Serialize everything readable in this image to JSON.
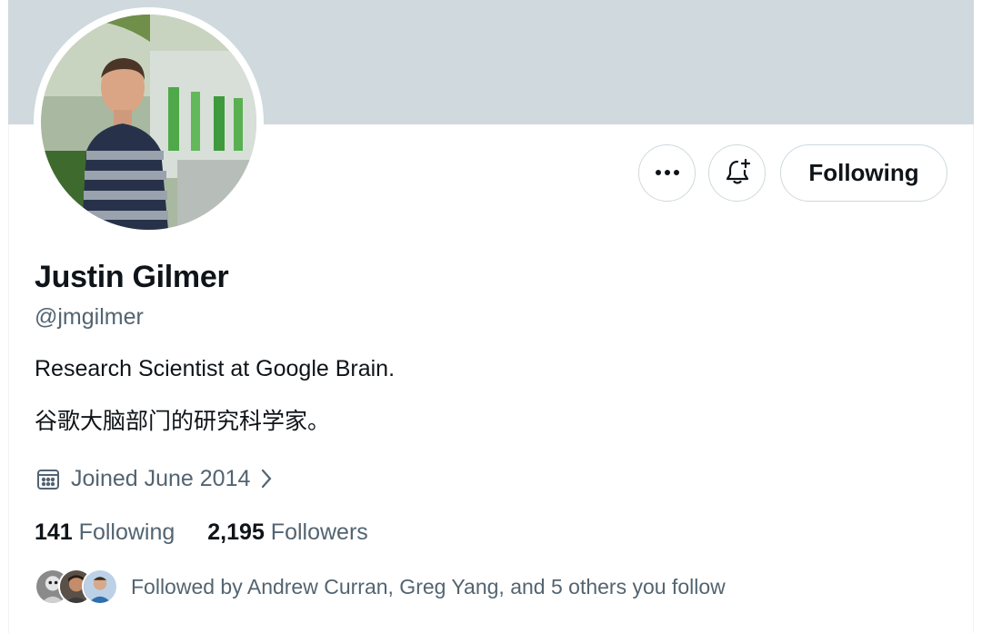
{
  "profile": {
    "name": "Justin Gilmer",
    "handle": "@jmgilmer",
    "bio_line1": "Research Scientist at Google Brain.",
    "bio_line2": "谷歌大脑部门的研究科学家。",
    "joined": "Joined June 2014"
  },
  "actions": {
    "more_icon": "more-horizontal-icon",
    "notify_icon": "bell-plus-icon",
    "following_label": "Following"
  },
  "stats": {
    "following_count": "141",
    "following_label": "Following",
    "followers_count": "2,195",
    "followers_label": "Followers"
  },
  "followed_by": {
    "text": "Followed by Andrew Curran, Greg Yang, and 5 others you follow"
  },
  "colors": {
    "banner": "#cfd9de",
    "text_primary": "#0f1419",
    "text_secondary": "#536471",
    "border": "#cfd9de"
  }
}
